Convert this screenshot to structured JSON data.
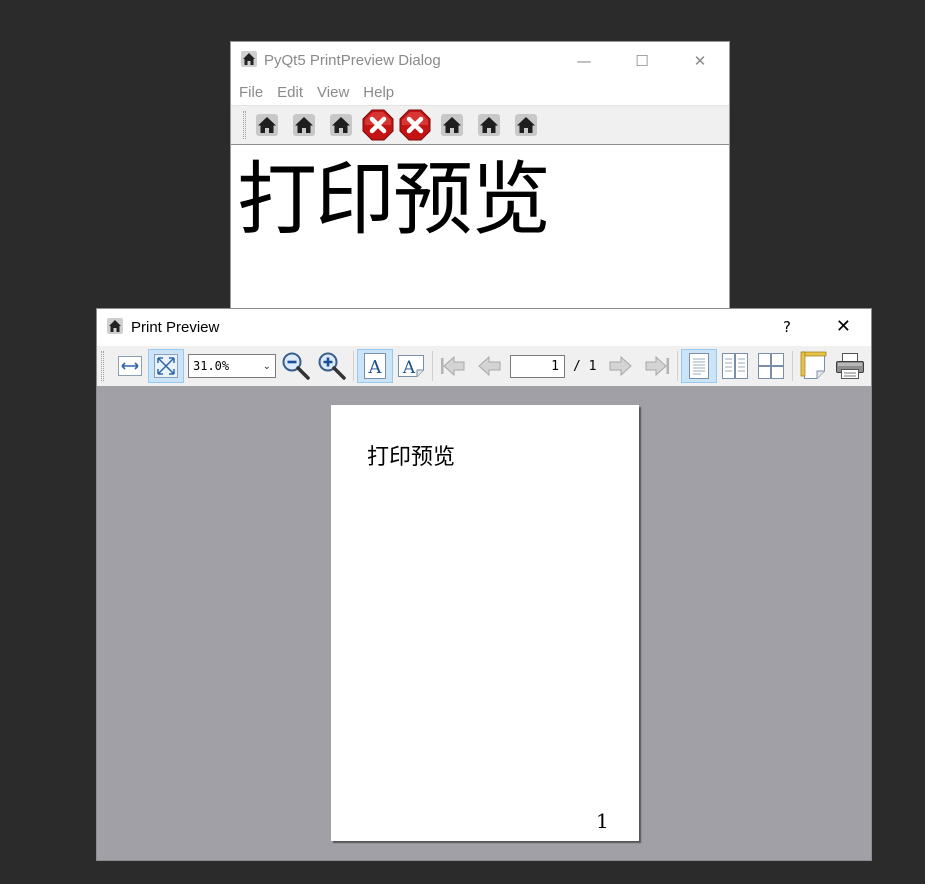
{
  "main_window": {
    "title": "PyQt5 PrintPreview Dialog",
    "controls": {
      "minimize": "—",
      "maximize": "☐",
      "close": "✕"
    },
    "menu": [
      "File",
      "Edit",
      "View",
      "Help"
    ],
    "toolbar_icons": [
      "home-icon",
      "home-icon",
      "home-icon",
      "error-icon",
      "error-icon",
      "home-icon",
      "home-icon",
      "home-icon"
    ],
    "content_text": "打印预览"
  },
  "preview_dialog": {
    "title": "Print Preview",
    "help_label": "?",
    "close_label": "✕",
    "toolbar": {
      "zoom_value": "31.0%",
      "current_page": "1",
      "page_total": "/ 1"
    },
    "page": {
      "text": "打印预览",
      "number": "1"
    }
  },
  "colors": {
    "desktop": "#2b2b2b",
    "canvas": "#a0a0a6",
    "active_button": "#cce4f7",
    "error_red": "#d21a1a"
  }
}
